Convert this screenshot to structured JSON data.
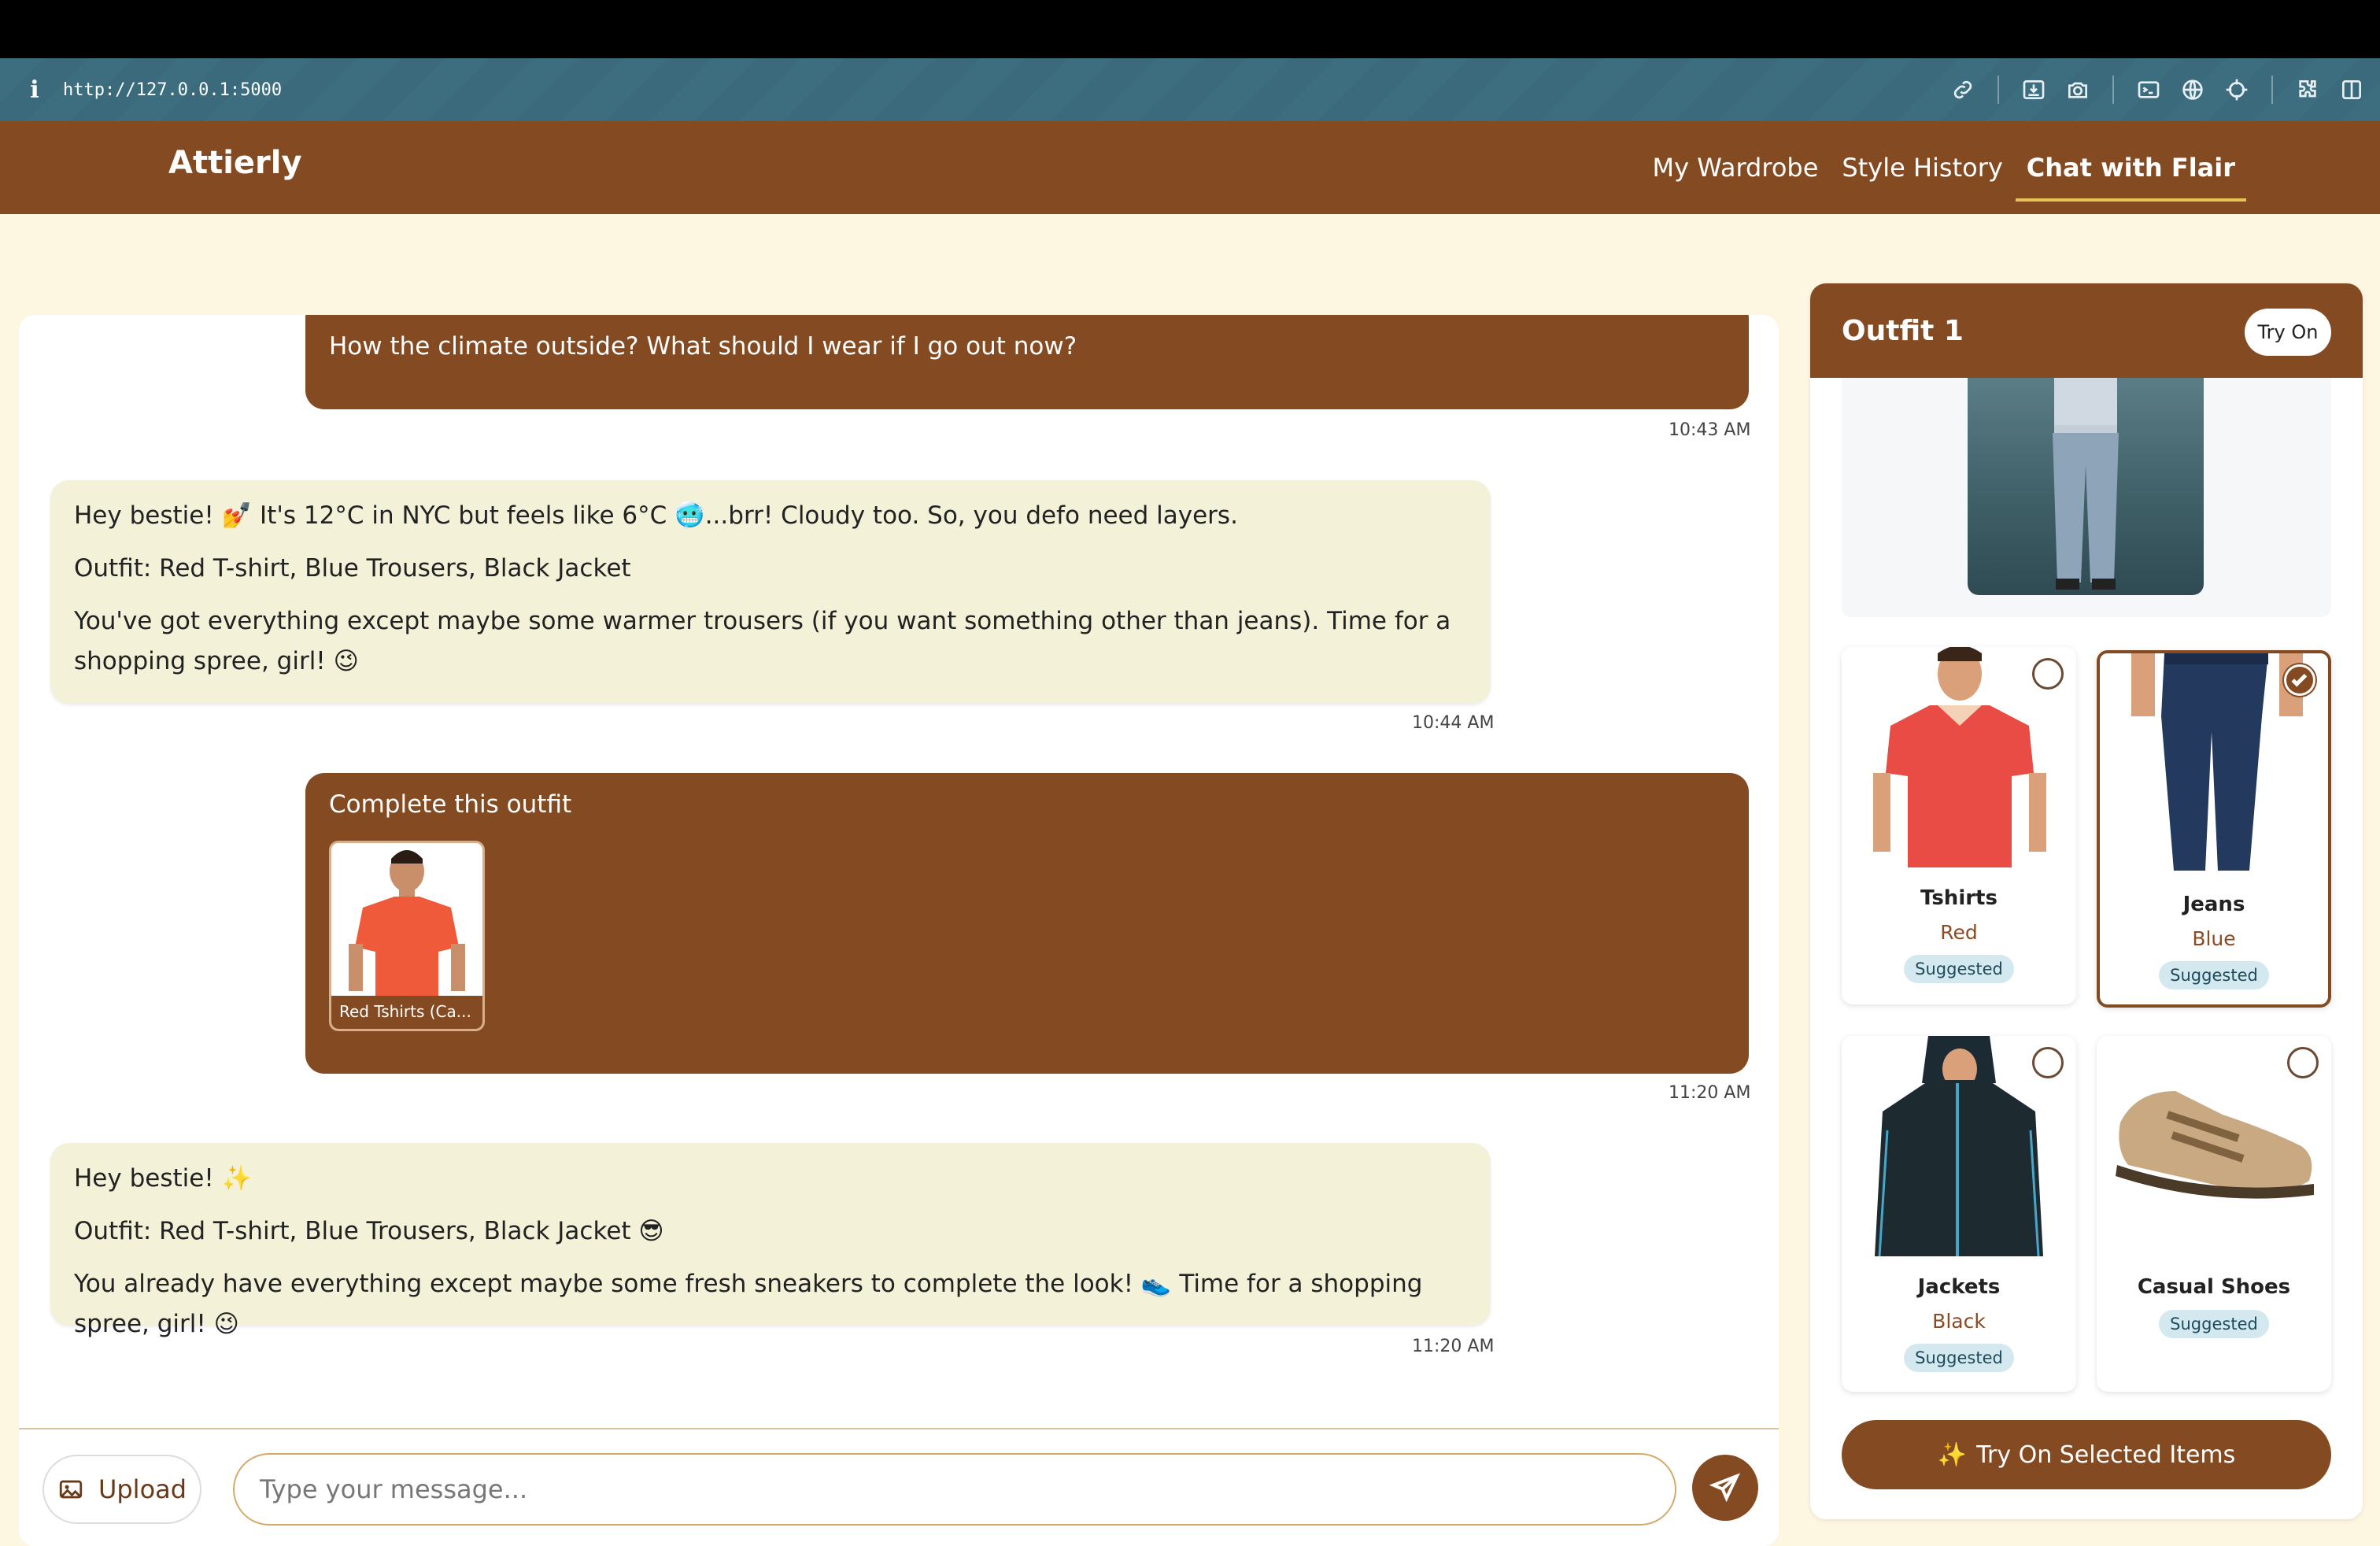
{
  "browser": {
    "url": "http://127.0.0.1:5000"
  },
  "header": {
    "brand": "Attierly",
    "nav": [
      "My Wardrobe",
      "Style History",
      "Chat with Flair"
    ]
  },
  "chat": {
    "messages": [
      {
        "role": "user",
        "text": "How the climate outside? What should I wear if I go out now?",
        "time": "10:43 AM"
      },
      {
        "role": "bot",
        "lines": [
          "Hey bestie! 💅 It's 12°C in NYC but feels like 6°C 🥶...brr! Cloudy too. So, you defo need layers.",
          "Outfit: Red T-shirt, Blue Trousers, Black Jacket",
          "You've got everything except maybe some warmer trousers (if you want something other than jeans). Time for a shopping spree, girl! 😉"
        ],
        "time": "10:44 AM"
      },
      {
        "role": "user",
        "text": "Complete this outfit",
        "attachment": "Red Tshirts (Ca...",
        "time": "11:20 AM"
      },
      {
        "role": "bot",
        "lines": [
          "Hey bestie! ✨",
          "Outfit: Red T-shirt, Blue Trousers, Black Jacket 😎",
          "You already have everything except maybe some fresh sneakers to complete the look! 👟 Time for a shopping spree, girl! 😉"
        ],
        "time": "11:20 AM"
      }
    ],
    "composer": {
      "upload_label": "Upload",
      "placeholder": "Type your message..."
    }
  },
  "outfit": {
    "title": "Outfit 1",
    "try_on_label": "Try On",
    "items": [
      {
        "name": "Tshirts",
        "color": "Red",
        "badge": "Suggested",
        "selected": false
      },
      {
        "name": "Jeans",
        "color": "Blue",
        "badge": "Suggested",
        "selected": true
      },
      {
        "name": "Jackets",
        "color": "Black",
        "badge": "Suggested",
        "selected": false
      },
      {
        "name": "Casual Shoes",
        "color": "",
        "badge": "Suggested",
        "selected": false
      }
    ],
    "try_on_selected_label": "Try On Selected Items"
  },
  "colors": {
    "brand_brown": "#844b22",
    "page_bg": "#fdf6e1",
    "bot_bubble": "#f4f1d9",
    "nav_underline": "#e7c257",
    "badge_bg": "#d3e8ef",
    "browser_bar": "#3c6e80"
  }
}
